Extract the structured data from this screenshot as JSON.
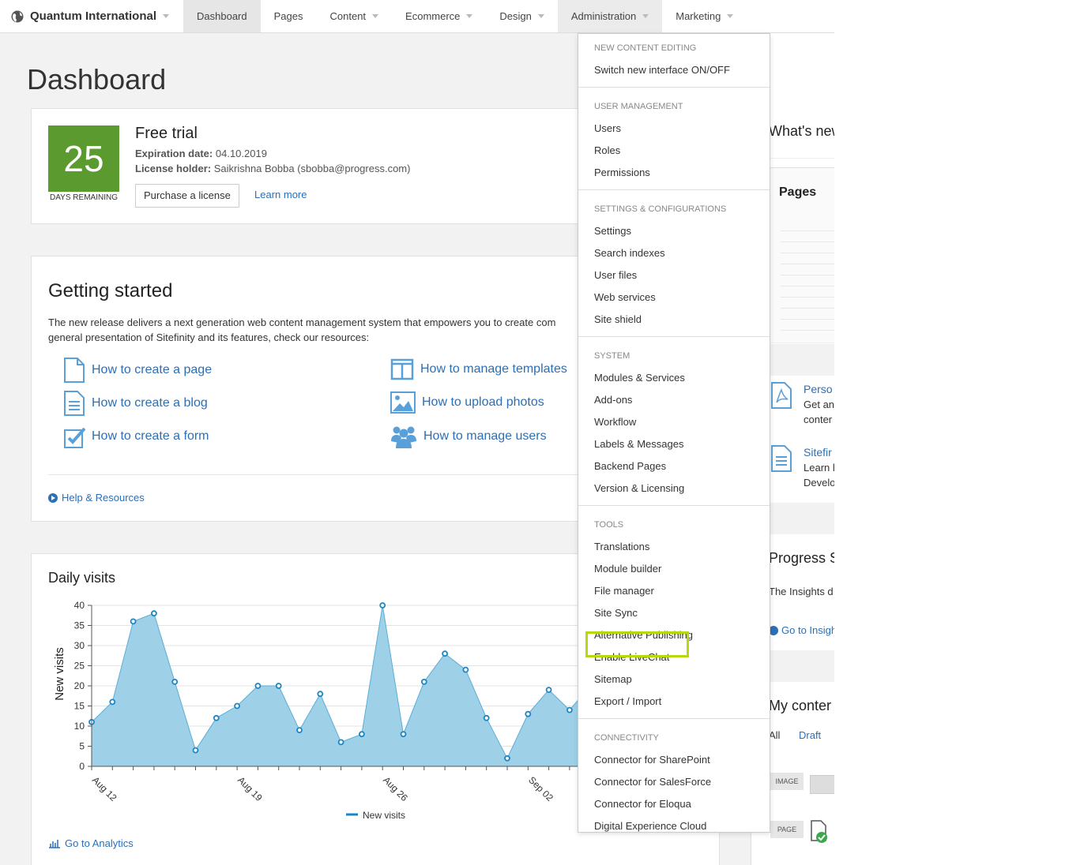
{
  "nav": {
    "brand": "Quantum International",
    "items": [
      "Dashboard",
      "Pages",
      "Content",
      "Ecommerce",
      "Design",
      "Administration",
      "Marketing"
    ]
  },
  "page_title": "Dashboard",
  "trial": {
    "days": "25",
    "days_label": "DAYS REMAINING",
    "title": "Free trial",
    "expiration_label": "Expiration date:",
    "expiration_value": "04.10.2019",
    "holder_label": "License holder:",
    "holder_value": "Saikrishna Bobba (sbobba@progress.com)",
    "purchase": "Purchase a license",
    "learn_more": "Learn more"
  },
  "started": {
    "title": "Getting started",
    "desc_line1": "The new release delivers a next generation web content management system that empowers you to create com",
    "desc_line2": "general presentation of Sitefinity and its features, check our resources:",
    "links": [
      "How to create a page",
      "How to create a blog",
      "How to create a form",
      "How to manage templates",
      "How to upload photos",
      "How to manage users"
    ],
    "help": "Help & Resources"
  },
  "visits": {
    "title": "Daily visits",
    "go": "Go to Analytics"
  },
  "chart_data": {
    "type": "area",
    "title": "Daily visits",
    "ylabel": "New visits",
    "xlabel": "",
    "ylim": [
      0,
      40
    ],
    "yticks": [
      0,
      5,
      10,
      15,
      20,
      25,
      30,
      35,
      40
    ],
    "xtick_labels": [
      "Aug 12",
      "Aug 19",
      "Aug 26",
      "Sep 02"
    ],
    "legend": "bottom",
    "series": [
      {
        "name": "New visits",
        "values": [
          11,
          16,
          36,
          38,
          21,
          4,
          12,
          15,
          20,
          20,
          9,
          18,
          6,
          8,
          40,
          8,
          21,
          28,
          24,
          12,
          2,
          13,
          19,
          14,
          20
        ]
      }
    ],
    "colors": {
      "fill": "#9ed0e8",
      "line": "#5aaed6",
      "marker": "#1a86c4"
    }
  },
  "right": {
    "whats_new": "What's new",
    "thumb_title": "Pages",
    "perso_title": "Perso",
    "perso_l1": "Get an",
    "perso_l2": "conter",
    "site_title": "Sitefir",
    "site_l1": "Learn l",
    "site_l2": "Develo",
    "progress_title": "Progress S",
    "progress_text": "The Insights d",
    "go_insight": "Go to Insigh",
    "my_content": "My conter",
    "filter_all": "All",
    "filter_draft": "Draft",
    "tag_image": "IMAGE",
    "tag_page": "PAGE"
  },
  "dropdown": {
    "sections": [
      {
        "head": "NEW CONTENT EDITING",
        "items": [
          "Switch new interface ON/OFF"
        ]
      },
      {
        "head": "USER MANAGEMENT",
        "items": [
          "Users",
          "Roles",
          "Permissions"
        ]
      },
      {
        "head": "SETTINGS & CONFIGURATIONS",
        "items": [
          "Settings",
          "Search indexes",
          "User files",
          "Web services",
          "Site shield"
        ]
      },
      {
        "head": "SYSTEM",
        "items": [
          "Modules & Services",
          "Add-ons",
          "Workflow",
          "Labels & Messages",
          "Backend Pages",
          "Version & Licensing"
        ]
      },
      {
        "head": "TOOLS",
        "items": [
          "Translations",
          "Module builder",
          "File manager",
          "Site Sync",
          "Alternative Publishing",
          "Enable LiveChat",
          "Sitemap",
          "Export / Import"
        ]
      },
      {
        "head": "CONNECTIVITY",
        "items": [
          "Connector for SharePoint",
          "Connector for SalesForce",
          "Connector for Eloqua",
          "Digital Experience Cloud"
        ]
      }
    ]
  }
}
